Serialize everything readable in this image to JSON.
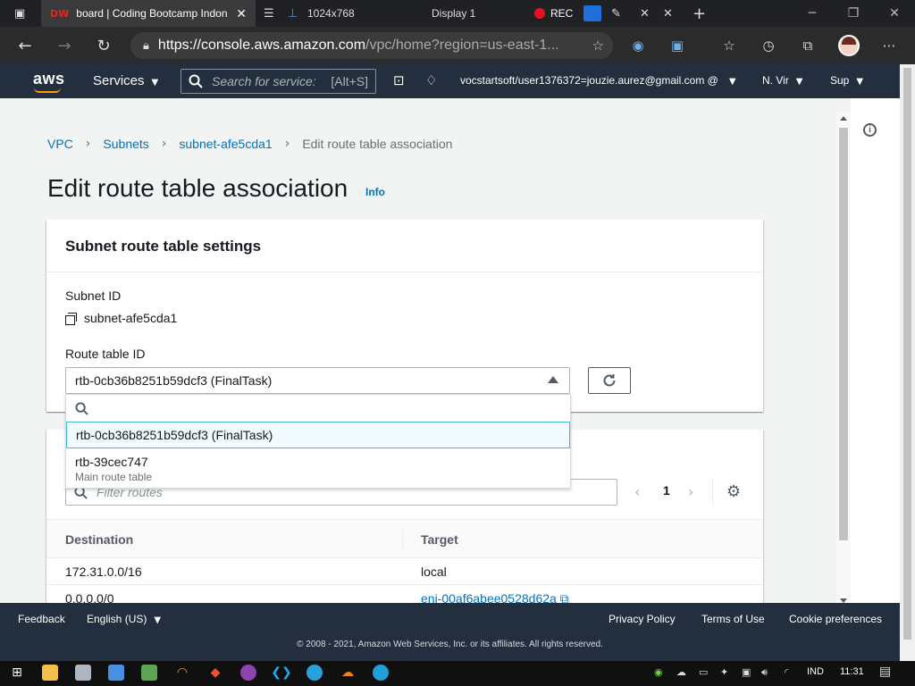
{
  "browser": {
    "active_tab_favicon": "DW",
    "active_tab_title": "board | Coding Bootcamp Indon",
    "display_tab_label": "1024x768",
    "display_title": "Display 1",
    "rec_label": "REC",
    "url_host": "https://console.aws.amazon.com",
    "url_path": "/vpc/home?region=us-east-1..."
  },
  "aws_nav": {
    "logo": "aws",
    "services_label": "Services",
    "search_placeholder": "Search for service:",
    "search_shortcut": "[Alt+S]",
    "account": "vocstartsoft/user1376372=jouzie.aurez@gmail.com @",
    "region": "N. Vir",
    "support": "Sup"
  },
  "breadcrumb": {
    "items": [
      "VPC",
      "Subnets",
      "subnet-afe5cda1"
    ],
    "current": "Edit route table association"
  },
  "page": {
    "title": "Edit route table association",
    "info_link": "Info",
    "info_panel_icon": "i"
  },
  "settings": {
    "header": "Subnet route table settings",
    "subnet_id_label": "Subnet ID",
    "subnet_id_value": "subnet-afe5cda1",
    "route_table_label": "Route table ID",
    "route_table_selected": "rtb-0cb36b8251b59dcf3 (FinalTask)"
  },
  "dropdown": {
    "options": [
      {
        "label": "rtb-0cb36b8251b59dcf3 (FinalTask)",
        "desc": ""
      },
      {
        "label": "rtb-39cec747",
        "desc": "Main route table"
      }
    ]
  },
  "routes": {
    "filter_placeholder": "Filter routes",
    "page_number": "1",
    "columns": [
      "Destination",
      "Target"
    ],
    "rows": [
      {
        "destination": "172.31.0.0/16",
        "target": "local"
      },
      {
        "destination": "0.0.0.0/0",
        "target": "eni-00af6abee0528d62a"
      }
    ]
  },
  "footer": {
    "feedback": "Feedback",
    "language": "English (US)",
    "privacy": "Privacy Policy",
    "terms": "Terms of Use",
    "cookies": "Cookie preferences",
    "copyright": "© 2008 - 2021, Amazon Web Services, Inc. or its affiliates. All rights reserved."
  },
  "taskbar": {
    "language": "IND",
    "time": "11:31"
  },
  "colors": {
    "aws_nav": "#232f3e",
    "link": "#0073bb",
    "aws_orange": "#ff9900",
    "selected_border": "#44b9d6"
  }
}
